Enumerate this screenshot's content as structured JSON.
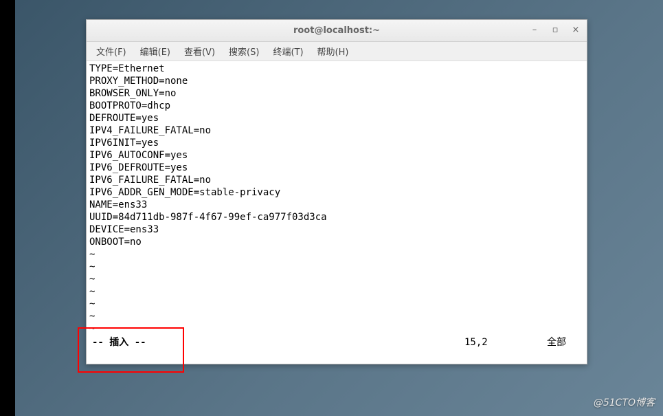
{
  "window": {
    "title": "root@localhost:~"
  },
  "controls": {
    "minimize": "–",
    "maximize": "▫",
    "close": "×"
  },
  "menu": {
    "file": "文件(F)",
    "edit": "编辑(E)",
    "view": "查看(V)",
    "search": "搜索(S)",
    "terminal": "终端(T)",
    "help": "帮助(H)"
  },
  "file_content": {
    "lines": [
      "TYPE=Ethernet",
      "PROXY_METHOD=none",
      "BROWSER_ONLY=no",
      "BOOTPROTO=dhcp",
      "DEFROUTE=yes",
      "IPV4_FAILURE_FATAL=no",
      "IPV6INIT=yes",
      "IPV6_AUTOCONF=yes",
      "IPV6_DEFROUTE=yes",
      "IPV6_FAILURE_FATAL=no",
      "IPV6_ADDR_GEN_MODE=stable-privacy",
      "NAME=ens33",
      "UUID=84d711db-987f-4f67-99ef-ca977f03d3ca",
      "DEVICE=ens33",
      "ONBOOT=no"
    ],
    "tilde_count": 7
  },
  "status": {
    "mode": "-- 插入 --",
    "position": "15,2",
    "scroll": "全部"
  },
  "tilde_char": "~",
  "watermark": "@51CTO博客"
}
